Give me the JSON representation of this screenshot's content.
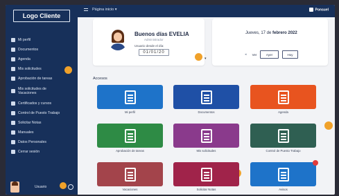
{
  "brand": {
    "logo_text": "Logo Cliente",
    "small_brand": "Ponsuel"
  },
  "breadcrumb": {
    "text": "Página inicio ▾"
  },
  "sidebar": {
    "items": [
      {
        "label": "Mi perfil",
        "icon": "user-icon"
      },
      {
        "label": "Documentos",
        "icon": "document-icon"
      },
      {
        "label": "Agenda",
        "icon": "calendar-icon"
      },
      {
        "label": "Mis solicitudes",
        "icon": "list-icon"
      },
      {
        "label": "Aprobación de tareas",
        "icon": "check-icon"
      },
      {
        "label": "Mis solicitudes de Vacaciones",
        "icon": "plane-icon"
      },
      {
        "label": "Certificados y cursos",
        "icon": "certificate-icon"
      },
      {
        "label": "Control de Puesto Trabajo",
        "icon": "clock-icon"
      },
      {
        "label": "Solicitar Notas",
        "icon": "note-icon"
      },
      {
        "label": "Manuales",
        "icon": "book-icon"
      },
      {
        "label": "Datos Personales",
        "icon": "id-icon"
      },
      {
        "label": "Cerrar sesión",
        "icon": "logout-icon"
      }
    ],
    "badge_value": "2",
    "user_badge_value": "1",
    "user_name": "Usuario"
  },
  "welcome": {
    "greeting": "Buenos días EVELIA",
    "role": "Administrador",
    "since_label": "Usuario desde el día:",
    "since_value": "01/01/20",
    "badge_value": "1"
  },
  "date_panel": {
    "title_prefix": "Jueves, 17 de",
    "title_bold": "febrero 2022",
    "buttons": [
      "Ver",
      "Ayer",
      "Hoy"
    ]
  },
  "shortcuts": {
    "title": "Accesos",
    "right_badge": "2",
    "middle_badge": "3",
    "tiles": [
      {
        "label": "Mi perfil",
        "color": "#1e73c9",
        "icon": "profile-card-icon"
      },
      {
        "label": "Documentos",
        "color": "#1f50a6",
        "icon": "documents-icon"
      },
      {
        "label": "Agenda",
        "color": "#e8541f",
        "icon": "agenda-icon"
      },
      {
        "label": "Aprobación de tareas",
        "color": "#2e8b45",
        "icon": "approval-calendar-icon"
      },
      {
        "label": "Mis solicitudes",
        "color": "#8a3a8c",
        "icon": "requests-check-icon"
      },
      {
        "label": "Control de Puesto Trabajo",
        "color": "#2f5f52",
        "icon": "workstation-icon"
      },
      {
        "label": "Vacaciones",
        "color": "#a3444b",
        "icon": "vacation-icon"
      },
      {
        "label": "Solicitar Notas",
        "color": "#a0234a",
        "icon": "add-note-icon"
      },
      {
        "label": "Avisos",
        "color": "#1e73c9",
        "icon": "notice-icon"
      }
    ]
  }
}
